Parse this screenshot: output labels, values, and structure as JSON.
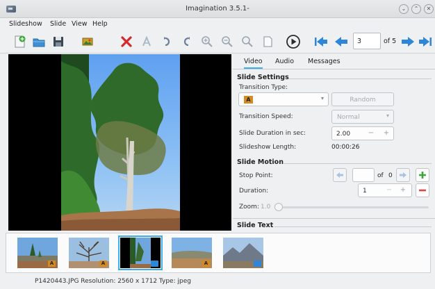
{
  "window": {
    "title": "Imagination 3.5.1-"
  },
  "menu": [
    "Slideshow",
    "Slide",
    "View",
    "Help"
  ],
  "toolbar": {
    "slide_number": "3",
    "of_label": "of 5"
  },
  "tabs": [
    {
      "label": "Video",
      "active": true
    },
    {
      "label": "Audio",
      "active": false
    },
    {
      "label": "Messages",
      "active": false
    }
  ],
  "slide_settings": {
    "heading": "Slide Settings",
    "transition_type_label": "Transition Type:",
    "transition_badge": "A",
    "random_label": "Random",
    "transition_speed_label": "Transition Speed:",
    "transition_speed_value": "Normal",
    "duration_label": "Slide Duration in sec:",
    "duration_value": "2.00",
    "length_label": "Slideshow Length:",
    "length_value": "00:00:26"
  },
  "slide_motion": {
    "heading": "Slide Motion",
    "stop_point_label": "Stop Point:",
    "stop_point_of": "of",
    "stop_point_total": "0",
    "duration_label": "Duration:",
    "duration_value": "1",
    "zoom_label": "Zoom:",
    "zoom_value": "1.0"
  },
  "slide_text": {
    "heading": "Slide Text"
  },
  "thumbnails": [
    {
      "badge": "A"
    },
    {
      "badge": "A"
    },
    {
      "badge": ""
    },
    {
      "badge": "A"
    },
    {
      "badge": ""
    }
  ],
  "status": {
    "text": "P1420443.JPG   Resolution: 2560 x 1712   Type: jpeg"
  },
  "colors": {
    "accent": "#3daee9",
    "delete_red": "#d8262b",
    "nav_blue": "#2f86d6",
    "add_green": "#3aa73a",
    "remove_red": "#e2424c"
  }
}
